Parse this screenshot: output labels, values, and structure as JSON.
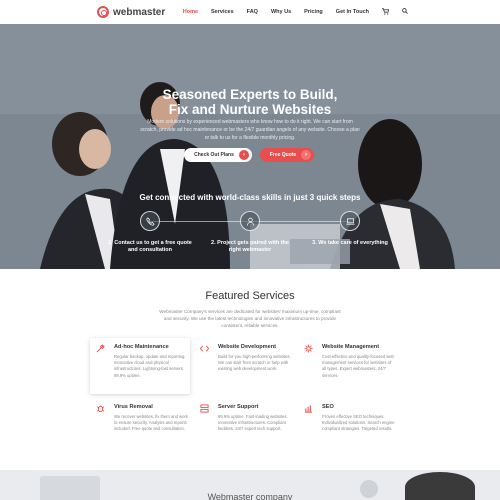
{
  "brand": {
    "name": "webmaster"
  },
  "nav": {
    "items": [
      {
        "label": "Home",
        "active": true
      },
      {
        "label": "Services",
        "active": false
      },
      {
        "label": "FAQ",
        "active": false
      },
      {
        "label": "Why Us",
        "active": false
      },
      {
        "label": "Pricing",
        "active": false
      },
      {
        "label": "Get In Touch",
        "active": false
      }
    ],
    "cart_icon": "cart-icon",
    "search_icon": "search-icon"
  },
  "hero": {
    "title_line1": "Seasoned Experts to Build,",
    "title_line2": "Fix and Nurture Websites",
    "subtitle": "Modern solutions by experienced webmasters who know how to do it right. We can start from scratch, provide ad hoc maintenance or be the 24/7 guardian angels of any website. Choose a plan or talk to us for a flexible monthly pricing.",
    "btn_plans": "Check Out Plans",
    "btn_quote": "Free Quote",
    "steps_title": "Get connected with world-class skills in just 3 quick steps",
    "steps": [
      {
        "icon": "phone-icon",
        "text": "1. Contact us to get a free quote and consultation"
      },
      {
        "icon": "user-icon",
        "text": "2. Project gets paired with the right webmaster"
      },
      {
        "icon": "laptop-icon",
        "text": "3. We take care of everything"
      }
    ]
  },
  "featured": {
    "title": "Featured Services",
    "subtitle": "Webmaster Company's services are dedicated for websites' maximum up-time, compliant and security. We use the latest technologies and innovative infrastructures to provide consistent, reliable services.",
    "services": [
      {
        "icon": "tools-icon",
        "title": "Ad-hoc Maintenance",
        "desc": "Regular backup, update and reporting. Innovative cloud and physical infrastructures. Lightning-fast servers. 99.9% uptime."
      },
      {
        "icon": "code-icon",
        "title": "Website Development",
        "desc": "Build for-you high-performing websites. We can start from scratch or help with existing web development work."
      },
      {
        "icon": "gear-icon",
        "title": "Website Management",
        "desc": "Cost-effective and quality-focused web management services for websites of all types. Expert webmasters, 24/7 services."
      },
      {
        "icon": "bug-icon",
        "title": "Virus Removal",
        "desc": "We recover websites, fix them and work to ensure security. Analysis and reports included. Free quote and consultation."
      },
      {
        "icon": "server-icon",
        "title": "Server Support",
        "desc": "99.9% uptime. Fast-loading websites. Innovative infrastructures. Compliant facilities. 24/7 expert tech support."
      },
      {
        "icon": "chart-icon",
        "title": "SEO",
        "desc": "Proven effective SEO techniques. Individualized solutions. Search engine compliant strategies. Targeted results."
      }
    ]
  },
  "bottom": {
    "title": "Webmaster company"
  },
  "colors": {
    "accent": "#e84e4e"
  }
}
